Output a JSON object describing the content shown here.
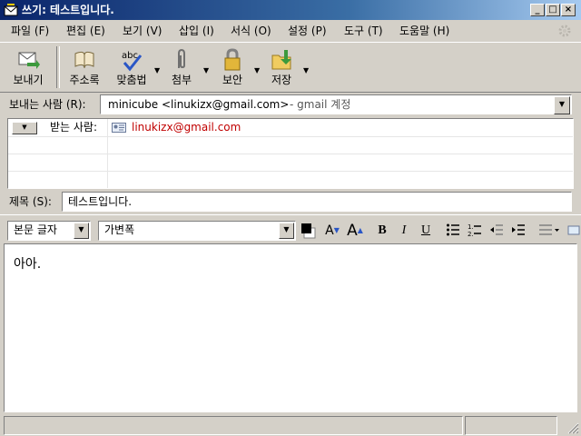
{
  "window": {
    "title": "쓰기: 테스트입니다."
  },
  "menu": [
    "파일 (F)",
    "편집 (E)",
    "보기 (V)",
    "삽입 (I)",
    "서식 (O)",
    "설정 (P)",
    "도구 (T)",
    "도움말 (H)"
  ],
  "toolbar": {
    "send": "보내기",
    "address_book": "주소록",
    "spell": "맞춤법",
    "attach": "첨부",
    "security": "보안",
    "save": "저장"
  },
  "from": {
    "label": "보내는 사람 (R):",
    "value": "minicube <linukizx@gmail.com>",
    "account": "- gmail 계정"
  },
  "recipients": [
    {
      "type": "받는 사람:",
      "address": "linukizx@gmail.com"
    }
  ],
  "subject": {
    "label": "제목 (S):",
    "value": "테스트입니다."
  },
  "format": {
    "paragraph": "본문 글자",
    "font": "가변폭"
  },
  "body": {
    "text": "아아."
  },
  "colors": {
    "titlebar": "#0a246a",
    "recipient": "#c00000"
  }
}
